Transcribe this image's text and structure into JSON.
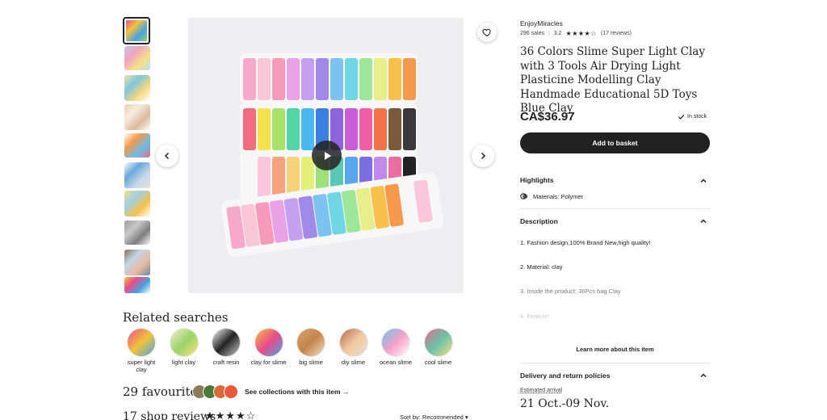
{
  "gallery": {
    "thumbnails": [
      {
        "name": "thumb-1",
        "colors": [
          "#e94b8a",
          "#f3c23b",
          "#4aa3e0",
          "#8fd16f"
        ]
      },
      {
        "name": "thumb-2",
        "colors": [
          "#c7c7e6",
          "#f0a4c2",
          "#f7e08a",
          "#b4e0f1"
        ]
      },
      {
        "name": "thumb-3",
        "colors": [
          "#f4e3a8",
          "#7ec6dd",
          "#f7d780",
          "#ffffff"
        ]
      },
      {
        "name": "thumb-4",
        "colors": [
          "#e9d3b7",
          "#f6ece0",
          "#d9b99a",
          "#ffffff"
        ]
      },
      {
        "name": "thumb-5",
        "colors": [
          "#ffffff",
          "#f29b4a",
          "#6bbde8",
          "#e96f8a"
        ]
      },
      {
        "name": "thumb-6",
        "colors": [
          "#ffffff",
          "#6aa7d8",
          "#c9d8e8",
          "#e2e2e2"
        ]
      },
      {
        "name": "thumb-7",
        "colors": [
          "#f6e07c",
          "#9ed0e6",
          "#f7c04a",
          "#ffffff"
        ]
      },
      {
        "name": "thumb-8",
        "colors": [
          "#9a9a9a",
          "#c8c8c8",
          "#7d7d7d",
          "#ffffff"
        ]
      },
      {
        "name": "thumb-9",
        "colors": [
          "#8a6f5a",
          "#c3d6e4",
          "#e6b9a2",
          "#6d8b9c"
        ]
      },
      {
        "name": "thumb-10",
        "colors": [
          "#f3c23b",
          "#e94b8a",
          "#4aa3e0",
          "#ffffff"
        ]
      }
    ],
    "clay_rows": [
      [
        "#f6a9c8",
        "#f7c7d7",
        "#f59ab8",
        "#e8a2e5",
        "#c5a0f0",
        "#9f8ae8",
        "#7dc3f2",
        "#6fd6e4",
        "#9fe59a",
        "#e8ef8a",
        "#f6c04a",
        "#f49a4a"
      ],
      [
        "#f46a7e",
        "#f3e24b",
        "#a7e36b",
        "#53d4a7",
        "#4cb8f0",
        "#3b7fe0",
        "#8d63e0",
        "#c95fd8",
        "#ee5fa8",
        "#f0734a",
        "#7b5a3b",
        "#3a3a3a"
      ],
      [
        "#f7f7f7",
        "#f9c7d9",
        "#f5a27d",
        "#f7d27a",
        "#e3f07a",
        "#9fe07a",
        "#58c9b4",
        "#57a6ee",
        "#7a6fe0",
        "#c08ae8",
        "#e96fa0",
        "#222222"
      ]
    ],
    "favourite_icon": "heart-icon",
    "prev_icon": "chevron-left-icon",
    "next_icon": "chevron-right-icon",
    "play_icon": "play-icon"
  },
  "related": {
    "title": "Related searches",
    "items": [
      {
        "label": "super light clay",
        "colors": [
          "#e94b8a",
          "#f3c23b",
          "#4aa3e0"
        ]
      },
      {
        "label": "light clay",
        "colors": [
          "#f4f0d0",
          "#9bd36b",
          "#f7e27a"
        ]
      },
      {
        "label": "craft resin",
        "colors": [
          "#ffffff",
          "#222222",
          "#cfcfcf"
        ]
      },
      {
        "label": "clay for slime",
        "colors": [
          "#f3c23b",
          "#e94b8a",
          "#4aa3e0"
        ]
      },
      {
        "label": "big slime",
        "colors": [
          "#d7a36b",
          "#c4854a",
          "#f0e0c8"
        ]
      },
      {
        "label": "diy slime",
        "colors": [
          "#b06a4a",
          "#f0c8a0",
          "#e8e0d0"
        ]
      },
      {
        "label": "ocean slime",
        "colors": [
          "#6cc7e8",
          "#f2a0c8",
          "#ffffff"
        ]
      },
      {
        "label": "cool slime",
        "colors": [
          "#e86a8a",
          "#6ac0a8",
          "#f7e08a"
        ]
      }
    ]
  },
  "favourites": {
    "count_text": "29 favourites",
    "dot_colors": [
      "#8a7a5a",
      "#4a7a3a",
      "#d86a3a",
      "#e8583a"
    ],
    "see_collections": "See collections with this item →"
  },
  "reviews": {
    "title": "17 shop reviews",
    "stars": "★★★★☆",
    "sort_label": "Sort by: Recommended ▾"
  },
  "product": {
    "shop_name": "EnjoyMiracles",
    "sales": "296 sales",
    "rating": "3.2",
    "stars": "★★★★☆",
    "reviews_count": "(17 reviews)",
    "title": "36 Colors Slime Super Light Clay with 3 Tools Air Drying Light Plasticine Modelling Clay Handmade Educational 5D Toys Blue Clay",
    "price": "CA$36.97",
    "stock": "In stock",
    "add_to_basket": "Add to basket"
  },
  "highlights": {
    "title": "Highlights",
    "material": "Materials: Polymer"
  },
  "description": {
    "title": "Description",
    "lines": [
      "1. Fashion design,100% Brand New,high quality!",
      "2. Material: clay",
      "3. Inside the product: 36Pcs bag Clay",
      "4. Feature!"
    ],
    "learn_more": "Learn more about this item"
  },
  "delivery": {
    "title": "Delivery and return policies",
    "estimated_label": "Estimated arrival",
    "date_range": "21 Oct.-09 Nov."
  }
}
